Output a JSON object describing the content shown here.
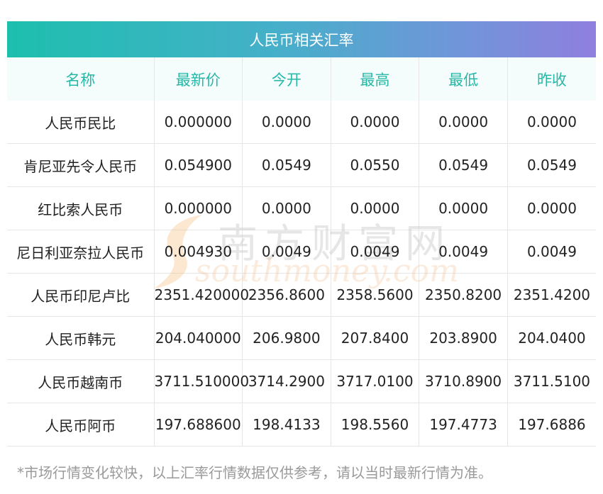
{
  "title": "人民币相关汇率",
  "columns": [
    "名称",
    "最新价",
    "今开",
    "最高",
    "最低",
    "昨收"
  ],
  "rows": [
    [
      "人民币民比",
      "0.000000",
      "0.0000",
      "0.0000",
      "0.0000",
      "0.0000"
    ],
    [
      "肯尼亚先令人民币",
      "0.054900",
      "0.0549",
      "0.0550",
      "0.0549",
      "0.0549"
    ],
    [
      "红比索人民币",
      "0.000000",
      "0.0000",
      "0.0000",
      "0.0000",
      "0.0000"
    ],
    [
      "尼日利亚奈拉人民币",
      "0.004930",
      "0.0049",
      "0.0049",
      "0.0049",
      "0.0049"
    ],
    [
      "人民币印尼卢比",
      "2351.420000",
      "2356.8600",
      "2358.5600",
      "2350.8200",
      "2351.4200"
    ],
    [
      "人民币韩元",
      "204.040000",
      "206.9800",
      "207.8400",
      "203.8900",
      "204.0400"
    ],
    [
      "人民币越南币",
      "3711.510000",
      "3714.2900",
      "3717.0100",
      "3710.8900",
      "3711.5100"
    ],
    [
      "人民币阿币",
      "197.688600",
      "198.4133",
      "198.5560",
      "197.4773",
      "197.6886"
    ]
  ],
  "watermark": {
    "cn": "南方财富网",
    "en": "southmoney.com"
  },
  "footnote": "*市场行情变化较快，以上汇率行情数据仅供参考，请以当时最新行情为准。",
  "colors": {
    "header_text": "#27b7a7",
    "header_bg": "#f4fdfc",
    "title_gradient_start": "#1dbfae",
    "title_gradient_end": "#8f7fde"
  }
}
